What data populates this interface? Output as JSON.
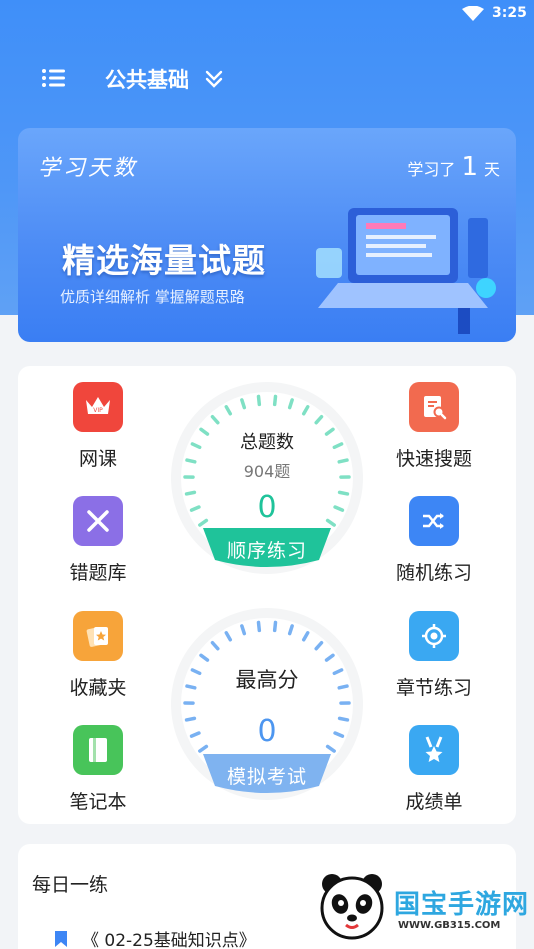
{
  "status_bar": {
    "time": "3:25"
  },
  "topbar": {
    "subject": "公共基础"
  },
  "banner": {
    "days_title": "学习天数",
    "studied_prefix": "学习了",
    "studied_days": "1",
    "studied_suffix": "天",
    "headline": "精选海量试题",
    "subline": "优质详细解析 掌握解题思路"
  },
  "tiles": {
    "online_course": {
      "label": "网课",
      "icon": "vip-crown-icon",
      "color": "#f0463c"
    },
    "quick_search": {
      "label": "快速搜题",
      "icon": "search-document-icon",
      "color": "#f26a4f"
    },
    "wrong_questions": {
      "label": "错题库",
      "icon": "close-icon",
      "color": "#8b6fe6"
    },
    "random_practice": {
      "label": "随机练习",
      "icon": "shuffle-icon",
      "color": "#3d86f5"
    },
    "favorites": {
      "label": "收藏夹",
      "icon": "star-card-icon",
      "color": "#f7a43a"
    },
    "chapter_practice": {
      "label": "章节练习",
      "icon": "target-icon",
      "color": "#3aa8f2"
    },
    "notes": {
      "label": "笔记本",
      "icon": "notebook-icon",
      "color": "#48c45a"
    },
    "report_card": {
      "label": "成绩单",
      "icon": "medal-icon",
      "color": "#3aa8f2"
    }
  },
  "practice_gauge": {
    "title": "总题数",
    "total": "904题",
    "value": "0",
    "button": "顺序练习",
    "color": "#1fc39a"
  },
  "exam_gauge": {
    "title": "最高分",
    "value": "0",
    "button": "模拟考试",
    "color": "#4d96f0"
  },
  "daily": {
    "title": "每日一练",
    "item": "《 02-25基础知识点》"
  },
  "watermark": {
    "brand": "国宝手游网",
    "url": "WWW.GB315.COM"
  }
}
